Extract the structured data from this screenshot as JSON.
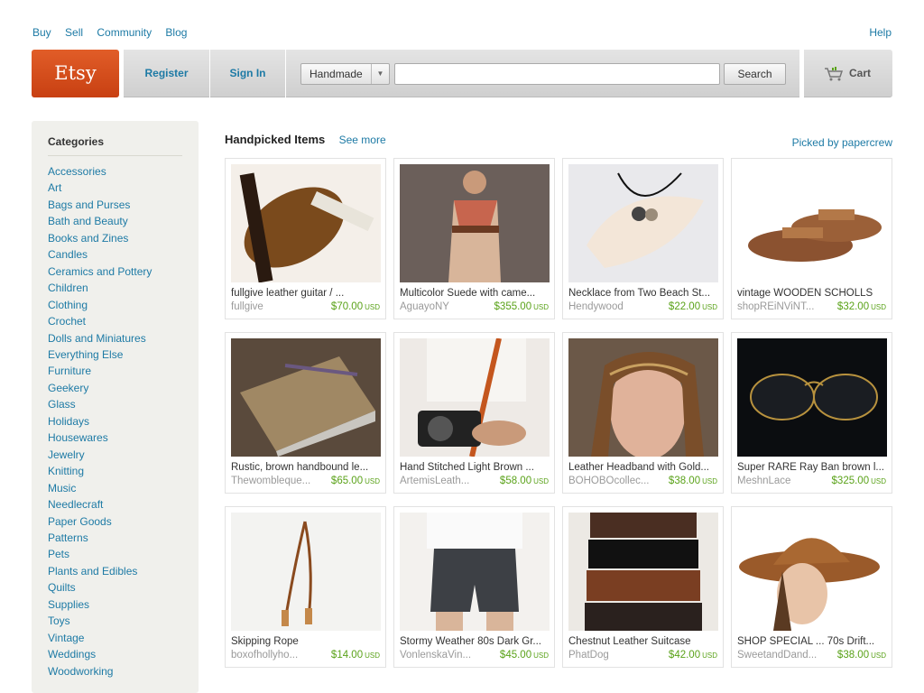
{
  "toplinks": {
    "buy": "Buy",
    "sell": "Sell",
    "community": "Community",
    "blog": "Blog",
    "help": "Help"
  },
  "header": {
    "logo": "Etsy",
    "register": "Register",
    "sign_in": "Sign In",
    "search_category": "Handmade",
    "search_value": "",
    "search_button": "Search",
    "cart": "Cart",
    "accent": "#d3501b",
    "link_color": "#1d7aa5"
  },
  "sidebar": {
    "title": "Categories",
    "items": [
      "Accessories",
      "Art",
      "Bags and Purses",
      "Bath and Beauty",
      "Books and Zines",
      "Candles",
      "Ceramics and Pottery",
      "Children",
      "Clothing",
      "Crochet",
      "Dolls and Miniatures",
      "Everything Else",
      "Furniture",
      "Geekery",
      "Glass",
      "Holidays",
      "Housewares",
      "Jewelry",
      "Knitting",
      "Music",
      "Needlecraft",
      "Paper Goods",
      "Patterns",
      "Pets",
      "Plants and Edibles",
      "Quilts",
      "Supplies",
      "Toys",
      "Vintage",
      "Weddings",
      "Woodworking"
    ]
  },
  "main": {
    "title": "Handpicked Items",
    "see_more": "See more",
    "picked_by": "Picked by papercrew",
    "currency": "USD",
    "price_color": "#5aa219",
    "items": [
      {
        "title": "fullgive leather guitar / ...",
        "seller": "fullgive",
        "price": "$70.00",
        "icon": "guitar-photo"
      },
      {
        "title": "Multicolor Suede with came...",
        "seller": "AguayoNY",
        "price": "$355.00",
        "icon": "dress-photo"
      },
      {
        "title": "Necklace from Two Beach St...",
        "seller": "Hendywood",
        "price": "$22.00",
        "icon": "necklace-photo"
      },
      {
        "title": "vintage WOODEN SCHOLLS",
        "seller": "shopREiNViNT...",
        "price": "$32.00",
        "icon": "sandals-photo"
      },
      {
        "title": "Rustic, brown handbound le...",
        "seller": "Thewombleque...",
        "price": "$65.00",
        "icon": "book-photo"
      },
      {
        "title": "Hand Stitched Light Brown ...",
        "seller": "ArtemisLeath...",
        "price": "$58.00",
        "icon": "camera-strap-photo"
      },
      {
        "title": "Leather Headband with Gold...",
        "seller": "BOHOBOcollec...",
        "price": "$38.00",
        "icon": "headband-photo"
      },
      {
        "title": "Super RARE Ray Ban brown l...",
        "seller": "MeshnLace",
        "price": "$325.00",
        "icon": "sunglasses-photo"
      },
      {
        "title": "Skipping Rope",
        "seller": "boxofhollyho...",
        "price": "$14.00",
        "icon": "rope-photo"
      },
      {
        "title": "Stormy Weather 80s Dark Gr...",
        "seller": "VonlenskaVin...",
        "price": "$45.00",
        "icon": "shorts-photo"
      },
      {
        "title": "Chestnut Leather Suitcase",
        "seller": "PhatDog",
        "price": "$42.00",
        "icon": "suitcase-photo"
      },
      {
        "title": "SHOP SPECIAL ... 70s Drift...",
        "seller": "SweetandDand...",
        "price": "$38.00",
        "icon": "hat-photo"
      }
    ]
  }
}
